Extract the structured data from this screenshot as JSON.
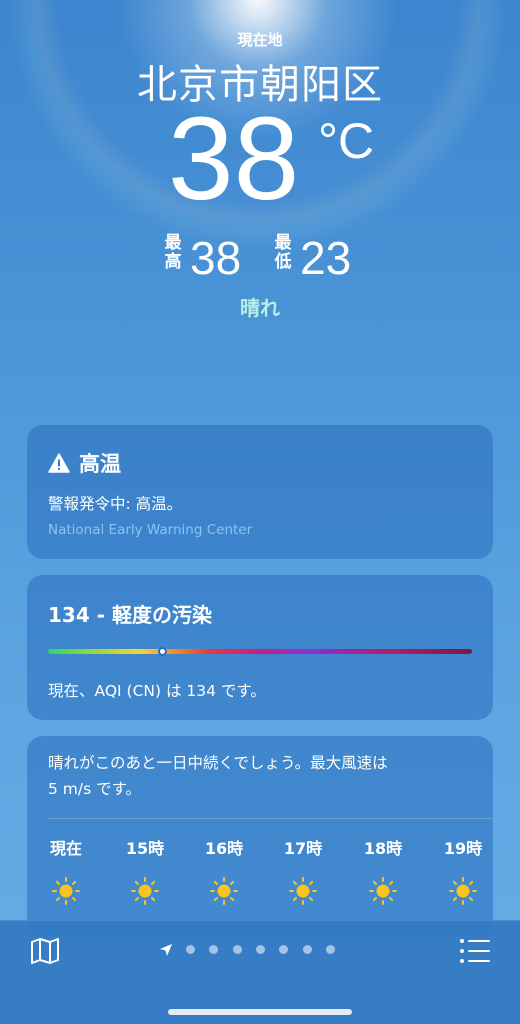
{
  "header": {
    "location_label": "現在地",
    "city": "北京市朝阳区",
    "temperature": "38",
    "unit": "°C",
    "high_label": "最高",
    "high_value": "38",
    "low_label": "最低",
    "low_value": "23",
    "condition": "晴れ"
  },
  "alert_card": {
    "icon": "warning-icon",
    "title": "高温",
    "body": "警報発令中: 高温。",
    "source": "National Early Warning Center"
  },
  "aqi_card": {
    "title": "134 - 軽度の汚染",
    "description": "現在、AQI (CN) は 134 です。",
    "level_fraction": 0.27
  },
  "forecast_card": {
    "summary_line1": "晴れがこのあと一日中続くでしょう。最大風速は",
    "summary_line2": "5 m/s です。",
    "hours": [
      {
        "label": "現在",
        "icon": "sun-icon"
      },
      {
        "label": "15時",
        "icon": "sun-icon"
      },
      {
        "label": "16時",
        "icon": "sun-icon"
      },
      {
        "label": "17時",
        "icon": "sun-icon"
      },
      {
        "label": "18時",
        "icon": "sun-icon"
      },
      {
        "label": "19時",
        "icon": "sun-icon"
      }
    ]
  },
  "tabbar": {
    "map_icon": "map-icon",
    "list_icon": "list-icon",
    "location_icon": "location-arrow-icon",
    "page_count": 8,
    "active_page": 1
  },
  "colors": {
    "condition_text": "#b8f0e6",
    "alert_source": "#8cc4f0",
    "sun": "#f7c51e"
  }
}
